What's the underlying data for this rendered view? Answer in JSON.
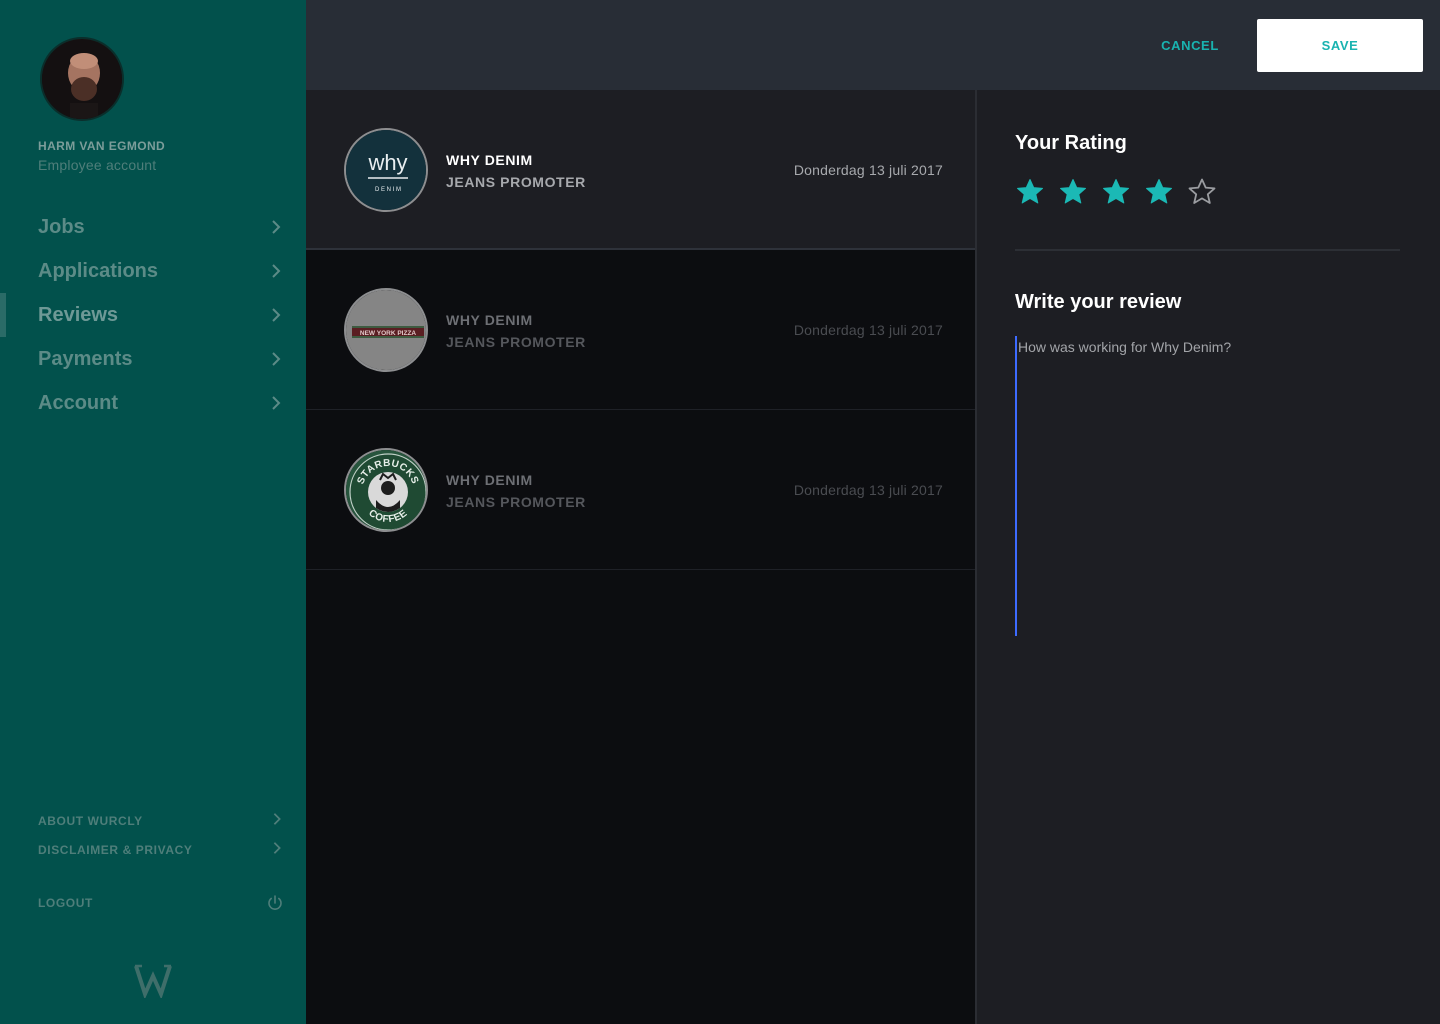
{
  "profile": {
    "name": "HARM VAN EGMOND",
    "account_type": "Employee account"
  },
  "nav": {
    "items": [
      {
        "label": "Jobs",
        "active": false
      },
      {
        "label": "Applications",
        "active": false
      },
      {
        "label": "Reviews",
        "active": true
      },
      {
        "label": "Payments",
        "active": false
      },
      {
        "label": "Account",
        "active": false
      }
    ]
  },
  "footer": {
    "about": "ABOUT WURCLY",
    "disclaimer": "DISCLAIMER & PRIVACY",
    "logout": "LOGOUT"
  },
  "topbar": {
    "cancel_label": "CANCEL",
    "save_label": "SAVE"
  },
  "reviews": [
    {
      "company": "WHY DENIM",
      "role": "JEANS PROMOTER",
      "date": "Donderdag 13 juli 2017",
      "logo": "why-denim-logo",
      "selected": true
    },
    {
      "company": "WHY DENIM",
      "role": "JEANS PROMOTER",
      "date": "Donderdag 13 juli 2017",
      "logo": "new-york-pizza-logo",
      "selected": false
    },
    {
      "company": "WHY DENIM",
      "role": "JEANS PROMOTER",
      "date": "Donderdag 13 juli 2017",
      "logo": "starbucks-coffee-logo",
      "selected": false
    }
  ],
  "logo_texts": {
    "why": "why",
    "denim": "D E N I M",
    "nyp": "NEW YORK PIZZA",
    "starbucks": "STARBUCKS",
    "coffee": "COFFEE"
  },
  "detail": {
    "rating_title": "Your Rating",
    "rating": 4,
    "max_rating": 5,
    "review_title": "Write your review",
    "review_placeholder": "How was working for Why Denim?",
    "review_value": ""
  },
  "colors": {
    "accent": "#19b3b0",
    "sidebar": "#02514c",
    "panel": "#1d1e23",
    "star_filled": "#1bb9b5",
    "star_empty": "#9a9ca0"
  }
}
